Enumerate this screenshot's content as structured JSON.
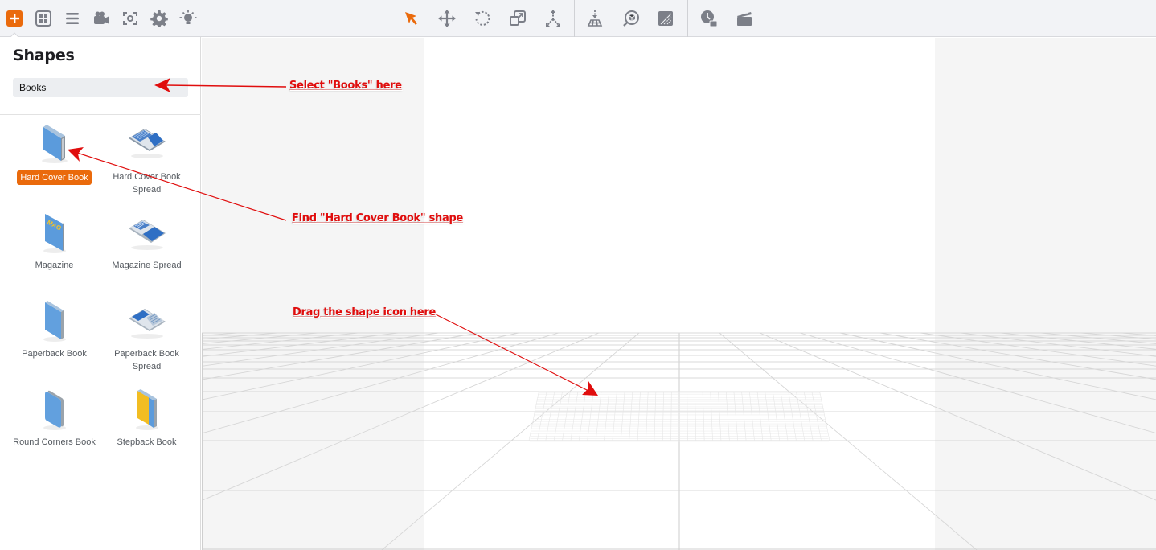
{
  "toolbar": {
    "left_tools": [
      {
        "name": "add-shape",
        "icon": "plus-square-icon",
        "active": true
      },
      {
        "name": "templates",
        "icon": "grid-icon"
      },
      {
        "name": "layers",
        "icon": "menu-icon"
      },
      {
        "name": "camera",
        "icon": "video-camera-icon"
      },
      {
        "name": "snapshot",
        "icon": "focus-icon"
      },
      {
        "name": "settings",
        "icon": "gear-icon"
      },
      {
        "name": "lighting",
        "icon": "bulb-icon"
      }
    ],
    "center_tools": [
      {
        "name": "select",
        "icon": "cursor-arrow-icon",
        "active": true
      },
      {
        "name": "move",
        "icon": "move-icon"
      },
      {
        "name": "rotate",
        "icon": "rotate-icon"
      },
      {
        "name": "scale",
        "icon": "scale-icon"
      },
      {
        "name": "explode",
        "icon": "explode-icon"
      },
      {
        "name": "drop-to-floor",
        "icon": "drop-floor-icon"
      },
      {
        "name": "view-object",
        "icon": "search-cube-icon"
      },
      {
        "name": "material",
        "icon": "texture-icon"
      },
      {
        "name": "timing",
        "icon": "clock-icon"
      },
      {
        "name": "animation",
        "icon": "clapperboard-icon"
      }
    ],
    "accent_color": "#ea6a0c",
    "icon_color": "#7c7f88"
  },
  "panel": {
    "title": "Shapes",
    "category": "Books",
    "shapes": [
      {
        "label": "Hard Cover Book",
        "selected": true
      },
      {
        "label": "Hard Cover Book Spread"
      },
      {
        "label": "Magazine"
      },
      {
        "label": "Magazine Spread"
      },
      {
        "label": "Paperback Book"
      },
      {
        "label": "Paperback Book Spread"
      },
      {
        "label": "Round Corners Book"
      },
      {
        "label": "Stepback Book"
      }
    ],
    "magazine_icon_text": "MAG"
  },
  "annotations": {
    "select_books": "Select \"Books\" here",
    "find_shape": "Find \"Hard Cover Book\" shape",
    "drag_here": "Drag the shape icon here",
    "color": "#e00d0d"
  }
}
